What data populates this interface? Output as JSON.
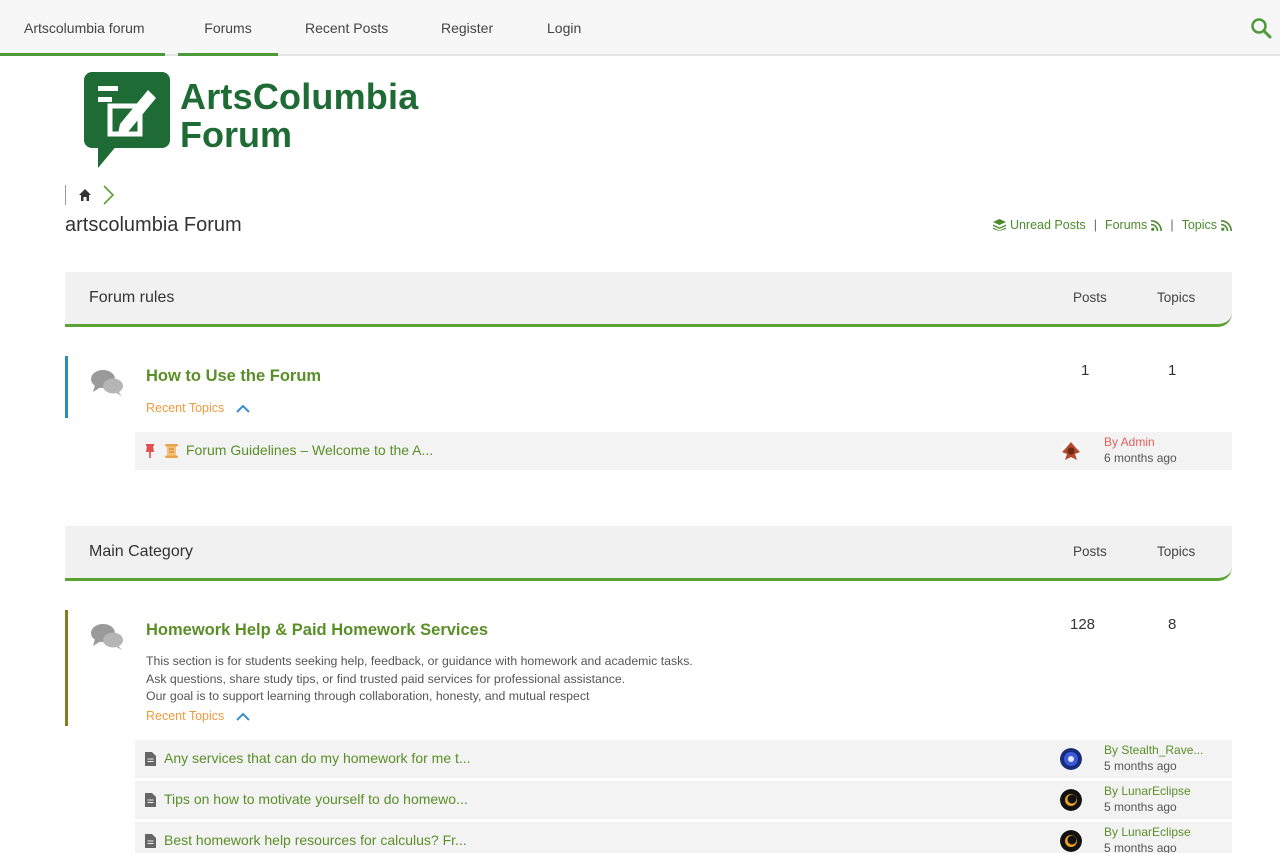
{
  "nav": {
    "site": "Artscolumbia forum",
    "items": [
      "Forums",
      "Recent Posts",
      "Register",
      "Login"
    ]
  },
  "logo": {
    "line1": "ArtsColumbia",
    "line2": "Forum"
  },
  "page_title": "artscolumbia Forum",
  "toplinks": {
    "unread": "Unread Posts",
    "forums": "Forums",
    "topics": "Topics"
  },
  "categories": [
    {
      "title": "Forum rules",
      "posts_label": "Posts",
      "topics_label": "Topics",
      "forum": {
        "name": "How to Use the Forum",
        "posts": "1",
        "topics": "1",
        "recent_label": "Recent Topics",
        "topics_list": [
          {
            "title": "Forum Guidelines – Welcome to the A...",
            "by": "By Admin",
            "ago": "6 months ago"
          }
        ]
      }
    },
    {
      "title": "Main Category",
      "posts_label": "Posts",
      "topics_label": "Topics",
      "forum": {
        "name": "Homework Help & Paid Homework Services",
        "posts": "128",
        "topics": "8",
        "desc": [
          "This section is for students seeking help, feedback, or guidance with homework and academic tasks.",
          "Ask questions, share study tips, or find trusted paid services for professional assistance.",
          "Our goal is to support learning through collaboration, honesty, and mutual respect"
        ],
        "recent_label": "Recent Topics",
        "topics_list": [
          {
            "title": "Any services that can do my homework for me t...",
            "by": "By Stealth_Rave...",
            "ago": "5 months ago"
          },
          {
            "title": "Tips on how to motivate yourself to do homewo...",
            "by": "By LunarEclipse",
            "ago": "5 months ago"
          },
          {
            "title": "Best homework help resources for calculus? Fr...",
            "by": "By LunarEclipse",
            "ago": "5 months ago"
          }
        ]
      }
    }
  ],
  "colors": {
    "accent": "#5aa233",
    "brand": "#1e6b35",
    "link": "#5a8f28",
    "orange": "#f09a3e"
  },
  "icons": [
    "search-icon",
    "home-icon",
    "chevron-right-icon",
    "layers-icon",
    "rss-icon",
    "chat-bubbles-icon",
    "pin-icon",
    "scroll-icon",
    "file-icon",
    "chevron-up-icon"
  ]
}
